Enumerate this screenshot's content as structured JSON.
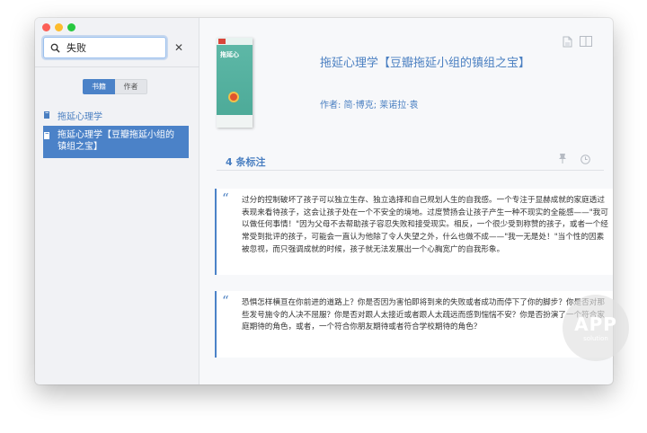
{
  "search": {
    "value": "失败"
  },
  "segments": {
    "books": "书籍",
    "authors": "作者"
  },
  "results": [
    {
      "title": "拖延心理学"
    },
    {
      "title": "拖延心理学【豆瓣拖延小组的镇组之宝】"
    }
  ],
  "book": {
    "cover_title": "拖延心",
    "title": "拖延心理学【豆瓣拖延小组的镇组之宝】",
    "author": "作者: 简·博克; 莱诺拉·袁"
  },
  "highlights": {
    "count_label": "4 条标注",
    "items": [
      {
        "text": "过分的控制破坏了孩子可以独立生存、独立选择和自己规划人生的自我感。一个专注于显赫成就的家庭透过表现来看待孩子，这会让孩子处在一个不安全的境地。过度赞扬会让孩子产生一种不现实的全能感——\"我可以做任何事情！\"因为父母不去帮助孩子容忍失败和接受现实。相反，一个很少受到称赞的孩子，或者一个经常受到批评的孩子，可能会一直认为他除了令人失望之外，什么也做不成——\"我一无是处！\"当个性的因素被忽视，而只强调成就的时候，孩子就无法发展出一个心胸宽广的自我形象。"
      },
      {
        "text": "恐惧怎样横亘在你前进的道路上？你是否因为害怕即将到来的失败或者成功而停下了你的脚步？你是否对那些发号施令的人决不屈服？你是否对跟人太接近或者跟人太疏远而感到惴惴不安？你是否扮演了一个符合家庭期待的角色，或者，一个符合你朋友期待或者符合学校期待的角色？"
      }
    ]
  },
  "watermark": {
    "line1": "APP",
    "line2": "solution"
  },
  "colors": {
    "accent": "#4b82c8",
    "link": "#4a7fc1"
  }
}
